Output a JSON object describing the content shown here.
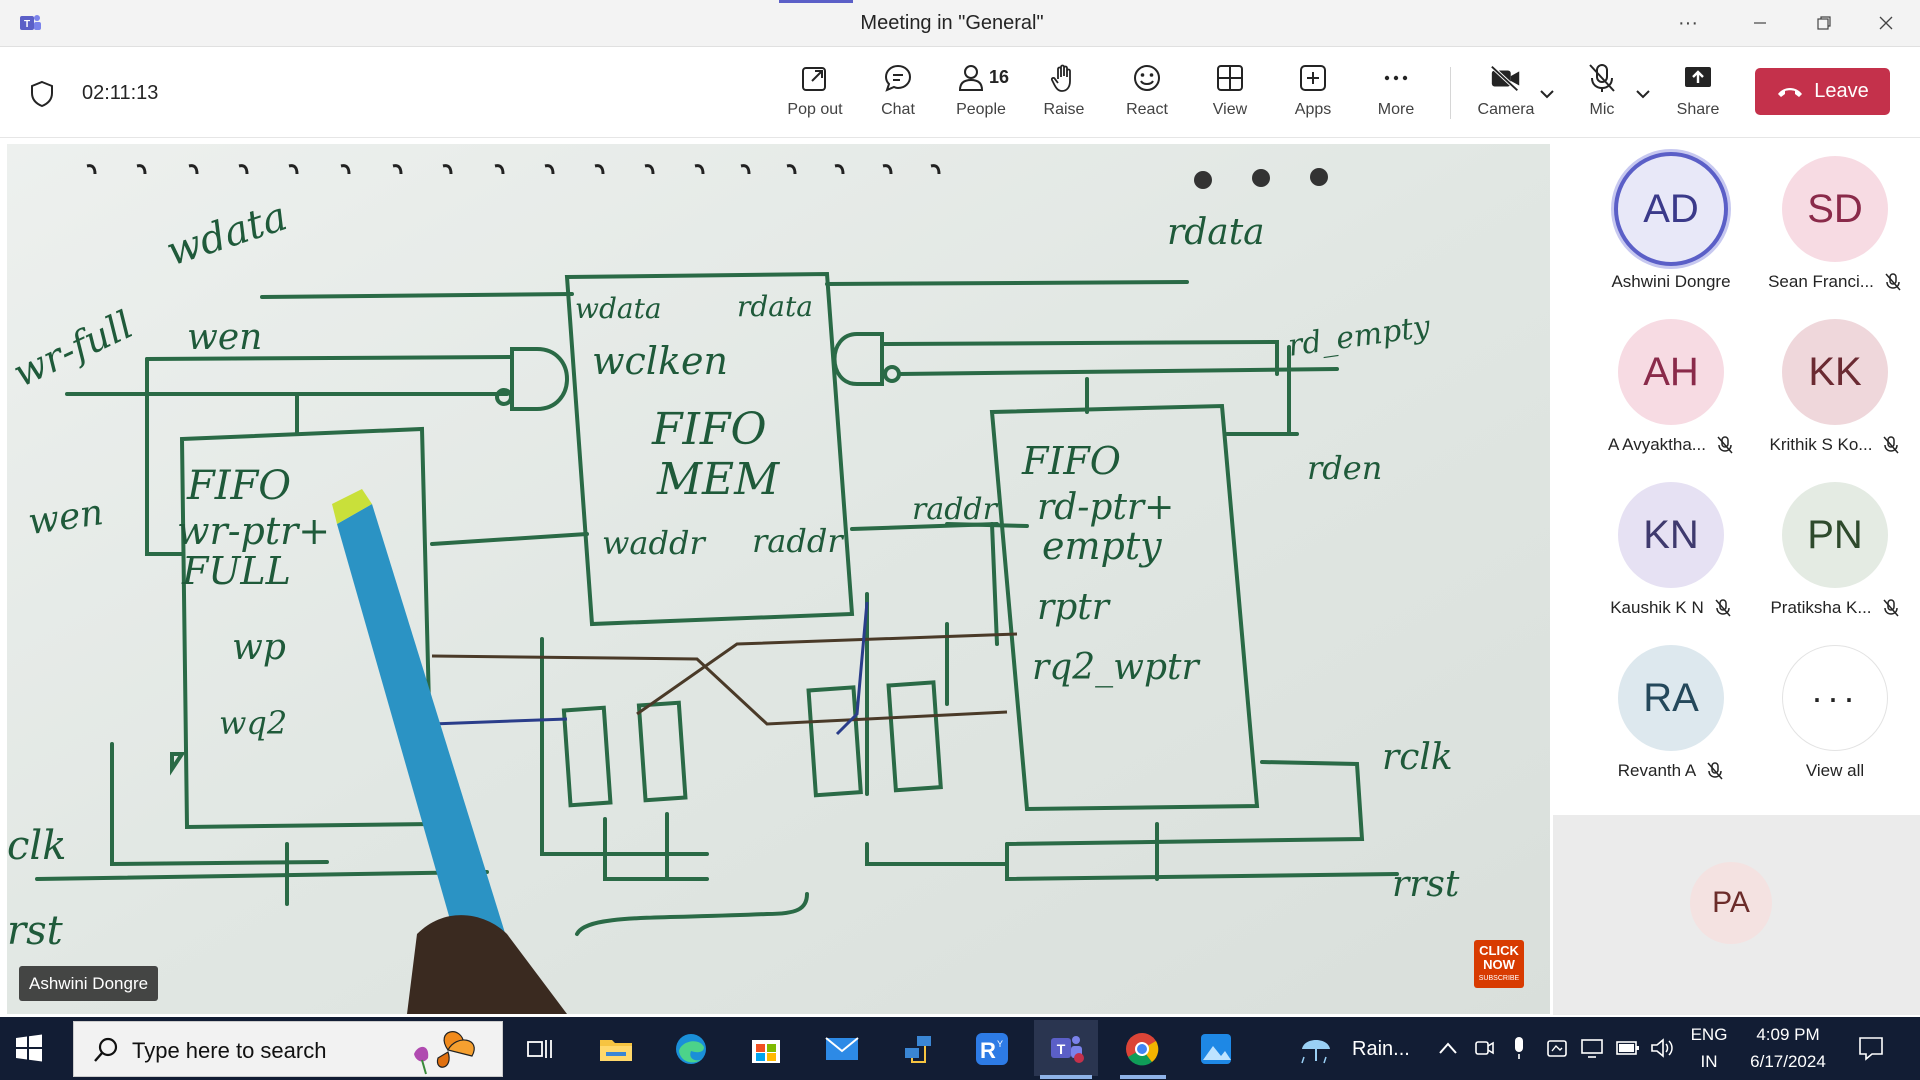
{
  "window": {
    "title": "Meeting in \"General\"",
    "more_symbol": "···"
  },
  "toolbar": {
    "timer": "02:11:13",
    "buttons": [
      {
        "label": "Pop out",
        "icon": "pop-out-icon"
      },
      {
        "label": "Chat",
        "icon": "chat-icon"
      },
      {
        "label": "People",
        "icon": "people-icon",
        "count": "16"
      },
      {
        "label": "Raise",
        "icon": "raise-hand-icon"
      },
      {
        "label": "React",
        "icon": "react-icon"
      },
      {
        "label": "View",
        "icon": "view-icon"
      },
      {
        "label": "Apps",
        "icon": "apps-icon"
      },
      {
        "label": "More",
        "icon": "more-icon"
      },
      {
        "label": "Camera",
        "icon": "camera-off-icon"
      },
      {
        "label": "Mic",
        "icon": "mic-off-icon"
      },
      {
        "label": "Share",
        "icon": "share-icon"
      }
    ],
    "leave_label": "Leave"
  },
  "stage": {
    "presenter_name": "Ashwini Dongre",
    "badge_line1": "CLICK",
    "badge_line2": "NOW",
    "badge_line3": "SUBSCRIBE"
  },
  "whiteboard": {
    "labels": {
      "wdata_in": "wdata",
      "wr_full": "wr-full",
      "wen_top": "wen",
      "wen_left": "wen",
      "wclk": "clk",
      "wrst": "rst",
      "fifo_wr_1": "FIFO",
      "fifo_wr_2": "wr-ptr+",
      "fifo_wr_3": "FULL",
      "wptr": "wp",
      "wq2": "wq2",
      "mem_wdata": "wdata",
      "mem_rdata": "rdata",
      "mem_wclken": "wclken",
      "mem_title_1": "FIFO",
      "mem_title_2": "MEM",
      "mem_waddr": "waddr",
      "mem_raddr": "raddr",
      "rdata_out": "rdata",
      "rd_empty": "rd_empty",
      "rden": "rden",
      "raddr_wire": "raddr",
      "fifo_rd_1": "FIFO",
      "fifo_rd_2": "rd-ptr+",
      "fifo_rd_3": "empty",
      "rptr": "rptr",
      "rq2_wptr": "rq2_wptr",
      "rclk": "rclk",
      "rrst": "rrst"
    }
  },
  "participants": [
    {
      "initials": "AD",
      "name": "Ashwini Dongre",
      "muted": false,
      "speaking": true,
      "bg": "#e8e8f8",
      "fg": "#3b3a8a"
    },
    {
      "initials": "SD",
      "name": "Sean Franci...",
      "muted": true,
      "speaking": false,
      "bg": "#f7dbe3",
      "fg": "#8a2a4a"
    },
    {
      "initials": "AH",
      "name": "A Avyaktha...",
      "muted": true,
      "speaking": false,
      "bg": "#f7dbe3",
      "fg": "#8a2a4a"
    },
    {
      "initials": "KK",
      "name": "Krithik S Ko...",
      "muted": true,
      "speaking": false,
      "bg": "#efd7db",
      "fg": "#6b2a32"
    },
    {
      "initials": "KN",
      "name": "Kaushik K N",
      "muted": true,
      "speaking": false,
      "bg": "#e6e1f3",
      "fg": "#3f3a6e"
    },
    {
      "initials": "PN",
      "name": "Pratiksha K...",
      "muted": true,
      "speaking": false,
      "bg": "#e4ebe3",
      "fg": "#2e4a2c"
    },
    {
      "initials": "RA",
      "name": "Revanth A",
      "muted": true,
      "speaking": false,
      "bg": "#dde8ee",
      "fg": "#24485b"
    }
  ],
  "view_all": {
    "label": "View all",
    "symbol": "···"
  },
  "self_view": {
    "initials": "PA"
  },
  "taskbar": {
    "search_placeholder": "Type here to search",
    "weather": "Rain...",
    "language_1": "ENG",
    "language_2": "IN",
    "time": "4:09 PM",
    "date": "6/17/2024",
    "colors": {
      "taskbar_bg": "#121d34",
      "leave_red": "#c4314b",
      "teams_purple": "#5b5fc7"
    }
  }
}
